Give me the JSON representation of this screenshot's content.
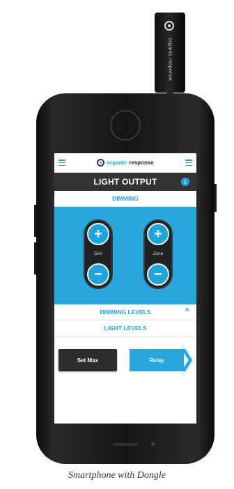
{
  "dongle": {
    "brand_text": "organic response",
    "icon": "organic-response-logo-icon"
  },
  "app": {
    "menu_icon_left": "hamburger-icon",
    "menu_icon_right": "hamburger-icon",
    "brand": {
      "name_accent": "organic",
      "name_rest": " response"
    },
    "title": "LIGHT OUTPUT",
    "info_icon": "i",
    "dimming_header": "DIMMING",
    "controls": {
      "dim": {
        "label": "Dim",
        "plus": "+",
        "minus": "−"
      },
      "zone": {
        "label": "Zone",
        "plus": "+",
        "minus": "−"
      }
    },
    "dimming_levels": "DIMMING LEVELS",
    "dimming_levels_chevron": "^",
    "light_levels": "LIGHT LEVELS",
    "buttons": {
      "set_max": "Set Max",
      "relay": "Relay"
    },
    "accent_color": "#27a7dc",
    "dark_color": "#333333"
  },
  "caption": "Smartphone with Dongle"
}
